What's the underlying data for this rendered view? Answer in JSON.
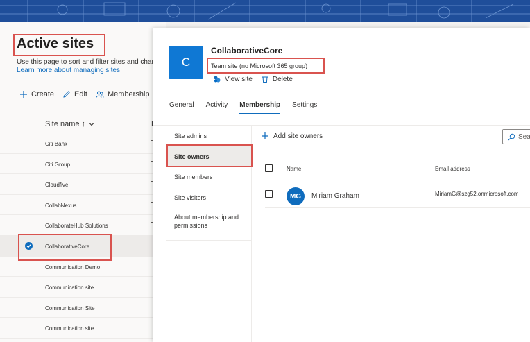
{
  "left_page": {
    "title": "Active sites",
    "description": "Use this page to sort and filter sites and chang",
    "learn_more": "Learn more about managing sites",
    "commands": [
      {
        "label": "Create",
        "icon": "plus-icon"
      },
      {
        "label": "Edit",
        "icon": "pencil-icon"
      },
      {
        "label": "Membership",
        "icon": "people-icon"
      }
    ],
    "column_header": "Site name ↑",
    "column_partial": "L",
    "sites": [
      "Citi Bank",
      "Citi Group",
      "Cloudfive",
      "CollabNexus",
      "CollaborateHub Solutions",
      "CollaborativeCore",
      "Communication Demo",
      "Communication site",
      "Communication Site",
      "Communication site"
    ],
    "selected_index": 5
  },
  "panel": {
    "tile_letter": "C",
    "title": "CollaborativeCore",
    "subtitle": "Team site (no Microsoft 365 group)",
    "actions": [
      {
        "label": "View site",
        "icon": "view-site-icon"
      },
      {
        "label": "Delete",
        "icon": "trash-icon"
      }
    ],
    "tabs": [
      "General",
      "Activity",
      "Membership",
      "Settings"
    ],
    "active_tab": "Membership",
    "nav": [
      "Site admins",
      "Site owners",
      "Site members",
      "Site visitors",
      "About membership and permissions"
    ],
    "selected_nav": "Site owners",
    "add_button": "Add site owners",
    "search_placeholder": "Sea",
    "table": {
      "headers": {
        "name": "Name",
        "email": "Email address"
      },
      "rows": [
        {
          "initials": "MG",
          "name": "Miriam Graham",
          "email": "MiriamG@szg52.onmicrosoft.com"
        }
      ]
    }
  },
  "colors": {
    "accent": "#0f6cbd",
    "tile": "#0f78d4",
    "highlight": "#d9534f",
    "banner": "#1f4e9a"
  }
}
